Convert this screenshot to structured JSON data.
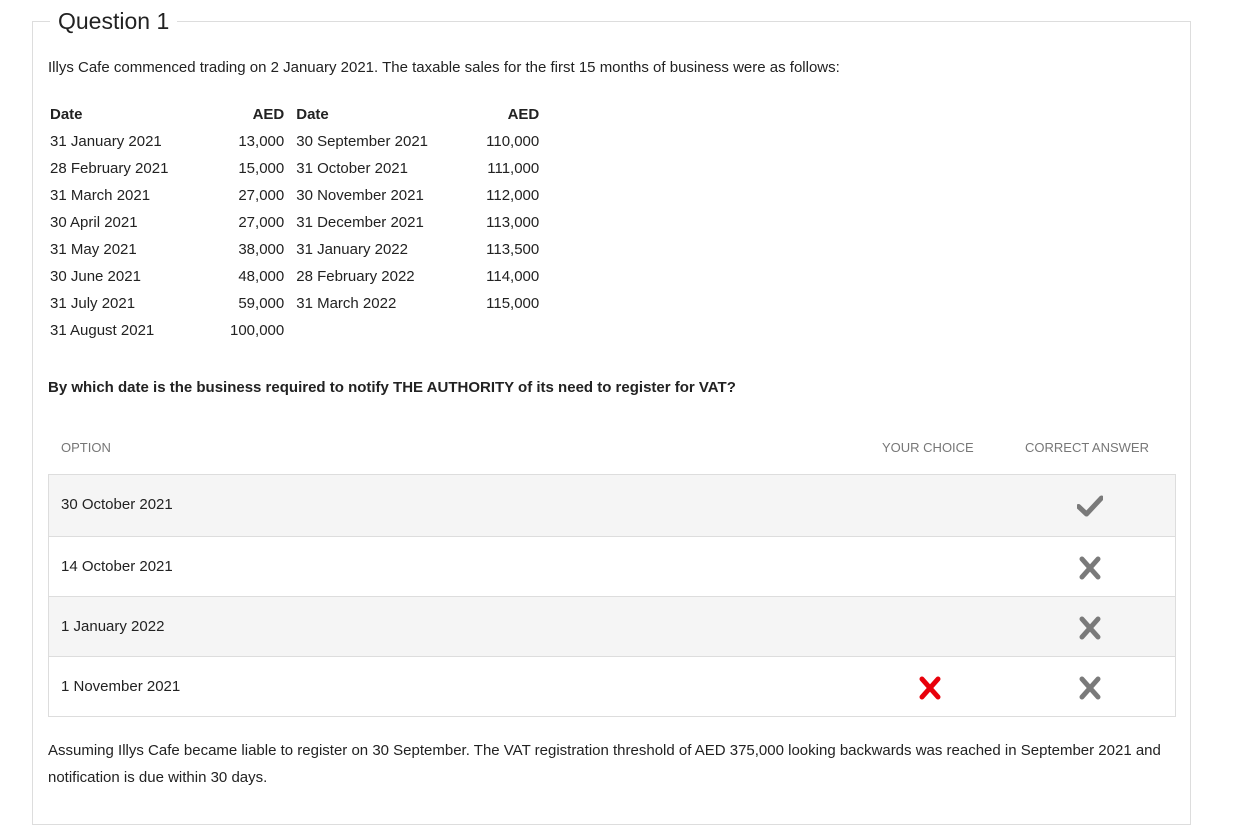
{
  "question": {
    "title": "Question 1",
    "intro": "Illys Cafe commenced trading on 2 January 2021. The taxable sales for the first 15 months of business were as follows:",
    "table": {
      "headers": [
        "Date",
        "AED",
        "Date",
        "AED"
      ],
      "rows": [
        [
          "31 January 2021",
          "13,000",
          "30 September 2021",
          "110,000"
        ],
        [
          "28 February 2021",
          "15,000",
          "31 October 2021",
          "111,000"
        ],
        [
          "31 March 2021",
          "27,000",
          "30 November 2021",
          "112,000"
        ],
        [
          "30 April 2021",
          "27,000",
          "31 December 2021",
          "113,000"
        ],
        [
          "31 May 2021",
          "38,000",
          "31 January 2022",
          "113,500"
        ],
        [
          "30 June 2021",
          "48,000",
          "28 February 2022",
          "114,000"
        ],
        [
          "31 July 2021",
          "59,000",
          "31 March 2022",
          "115,000"
        ],
        [
          "31 August 2021",
          "100,000",
          "",
          ""
        ]
      ]
    },
    "prompt": "By which date is the business required to notify THE AUTHORITY of its need to register for VAT?",
    "columns": {
      "option": "OPTION",
      "your_choice": "YOUR CHOICE",
      "correct_answer": "CORRECT ANSWER"
    },
    "options": [
      {
        "label": "30 October 2021",
        "selected": false,
        "correct": true
      },
      {
        "label": "14 October 2021",
        "selected": false,
        "correct": false
      },
      {
        "label": "1 January 2022",
        "selected": false,
        "correct": false
      },
      {
        "label": "1 November 2021",
        "selected": true,
        "correct": false
      }
    ],
    "explanation": "Assuming Illys Cafe became liable to register on 30 September. The VAT registration threshold of AED 375,000 looking backwards was reached in September 2021 and notification is due within 30 days."
  },
  "icons": {
    "correct_mark": "check-icon",
    "incorrect_mark": "cross-icon",
    "wrong_choice_mark": "red-cross-icon"
  },
  "colors": {
    "mark_grey": "#7a7a7a",
    "wrong_choice_red": "#e8000b",
    "row_shade": "#f5f5f5",
    "border": "#dddddd",
    "header_text": "#777777"
  }
}
